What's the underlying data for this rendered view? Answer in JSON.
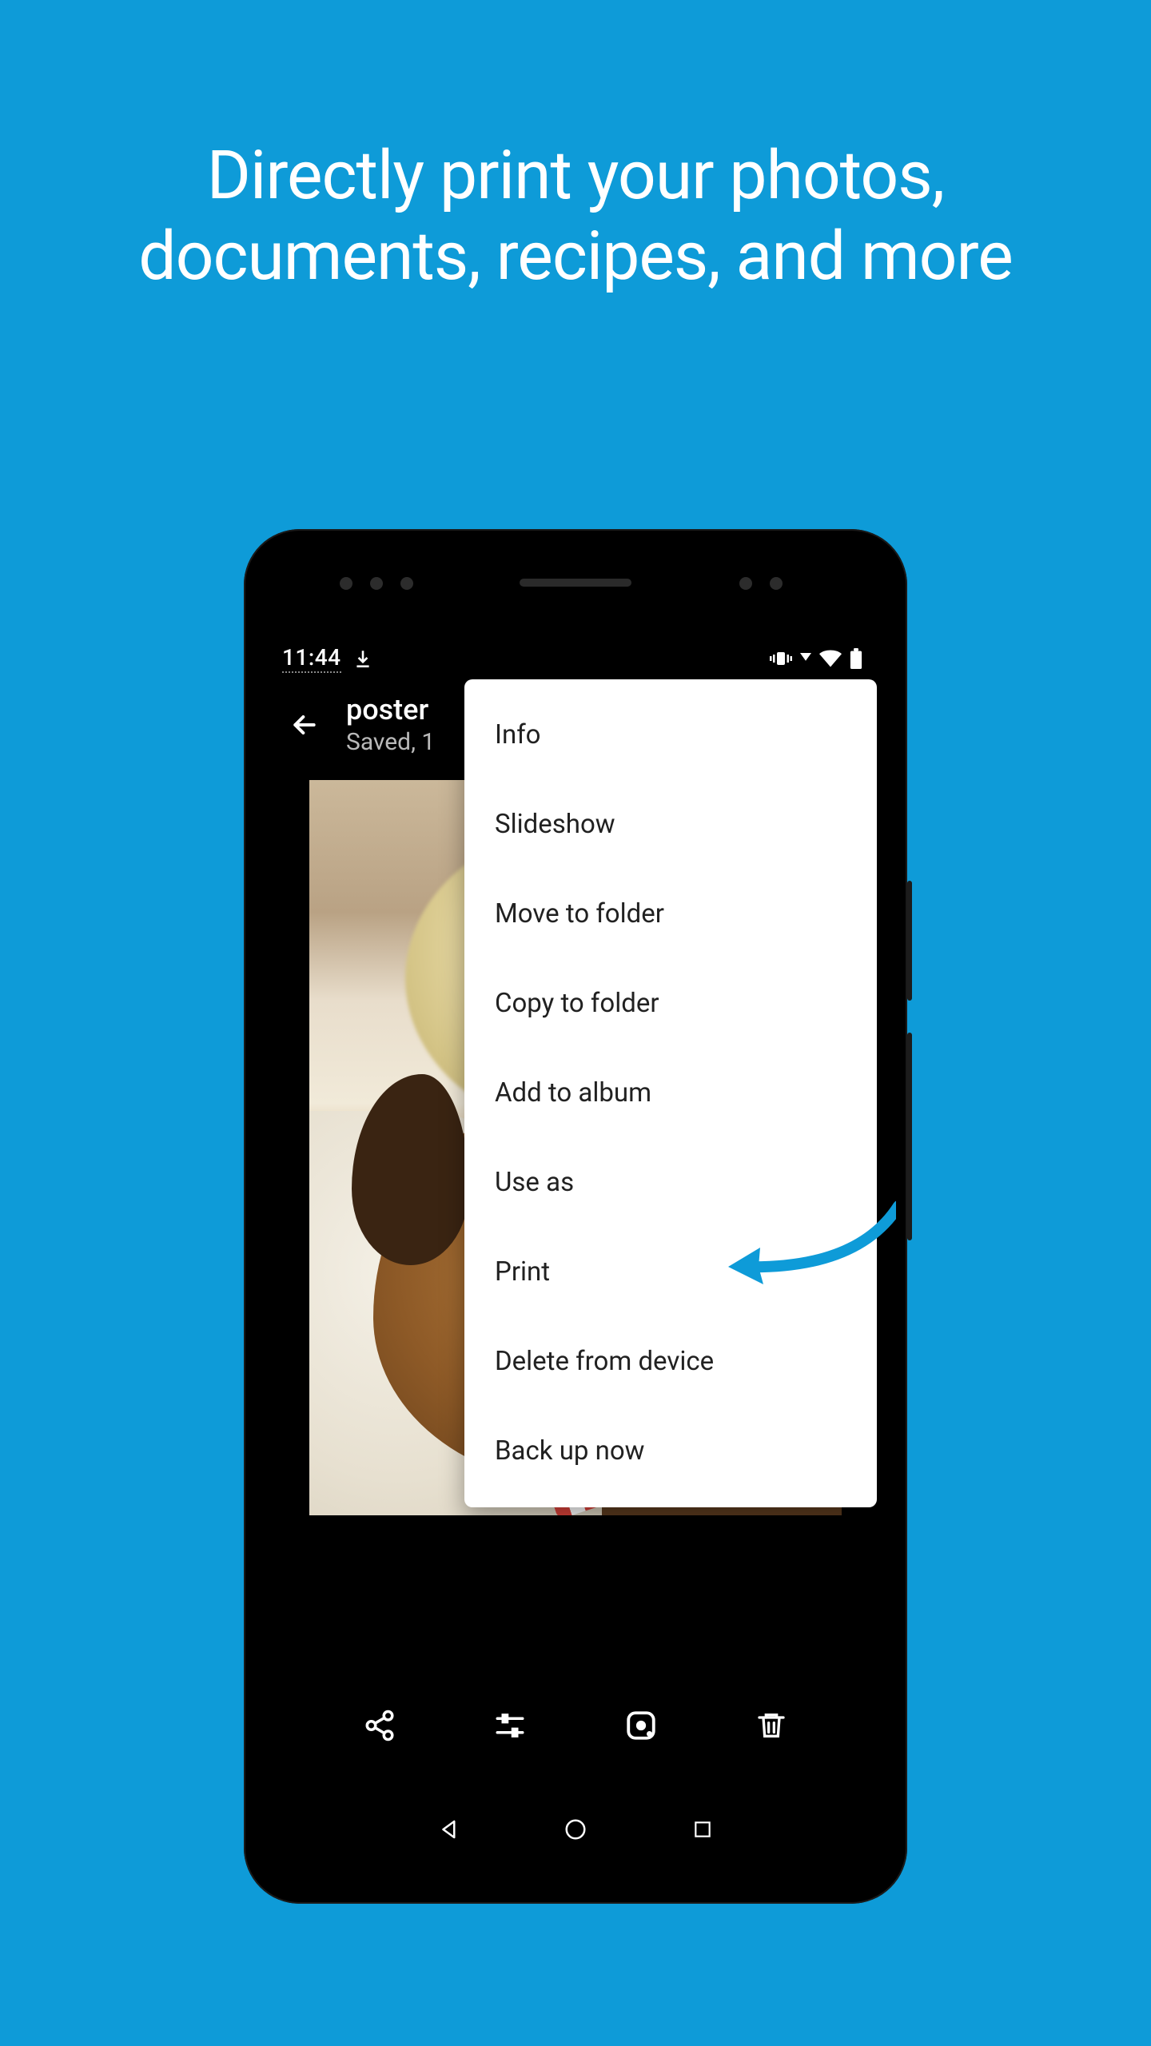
{
  "headline_line1": "Directly print your photos,",
  "headline_line2": "documents, recipes, and more",
  "status": {
    "time": "11:44"
  },
  "appbar": {
    "title": "poster",
    "subtitle": "Saved, 1"
  },
  "menu": {
    "items": [
      "Info",
      "Slideshow",
      "Move to folder",
      "Copy to folder",
      "Add to album",
      "Use as",
      "Print",
      "Delete from device",
      "Back up now"
    ]
  },
  "colors": {
    "background": "#0e9bd8",
    "accent": "#0e9bd8"
  }
}
